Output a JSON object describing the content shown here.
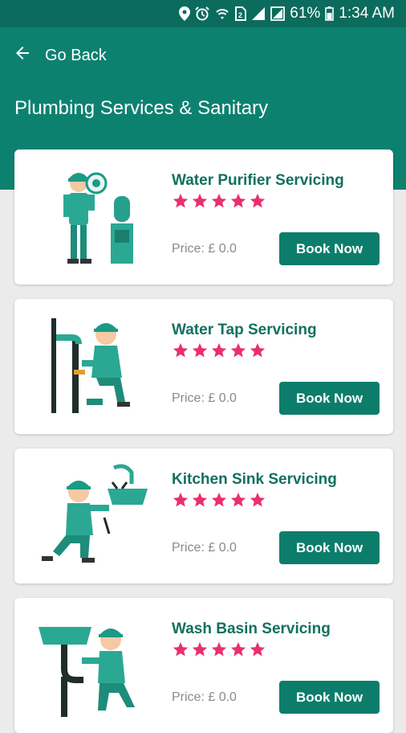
{
  "status_bar": {
    "battery_percent": "61%",
    "time": "1:34 AM",
    "icons": [
      "location-icon",
      "alarm-icon",
      "wifi-icon",
      "sim-icon",
      "signal-icon",
      "battery-icon"
    ]
  },
  "header": {
    "back_label": "Go Back",
    "title": "Plumbing Services & Sanitary"
  },
  "services": [
    {
      "name": "Water Purifier Servicing",
      "rating": 5,
      "price": "Price: £ 0.0",
      "button": "Book Now",
      "illustration": "water-purifier-illustration"
    },
    {
      "name": "Water Tap Servicing",
      "rating": 5,
      "price": "Price: £ 0.0",
      "button": "Book Now",
      "illustration": "water-tap-illustration"
    },
    {
      "name": "Kitchen Sink Servicing",
      "rating": 5,
      "price": "Price: £ 0.0",
      "button": "Book Now",
      "illustration": "kitchen-sink-illustration"
    },
    {
      "name": "Wash Basin Servicing",
      "rating": 5,
      "price": "Price: £ 0.0",
      "button": "Book Now",
      "illustration": "wash-basin-illustration"
    }
  ],
  "colors": {
    "status_bar": "#0b6b5c",
    "app_bar": "#0d8170",
    "accent_text": "#11705f",
    "button": "#0d7d6b",
    "star": "#e8306f",
    "background": "#ebebeb"
  }
}
